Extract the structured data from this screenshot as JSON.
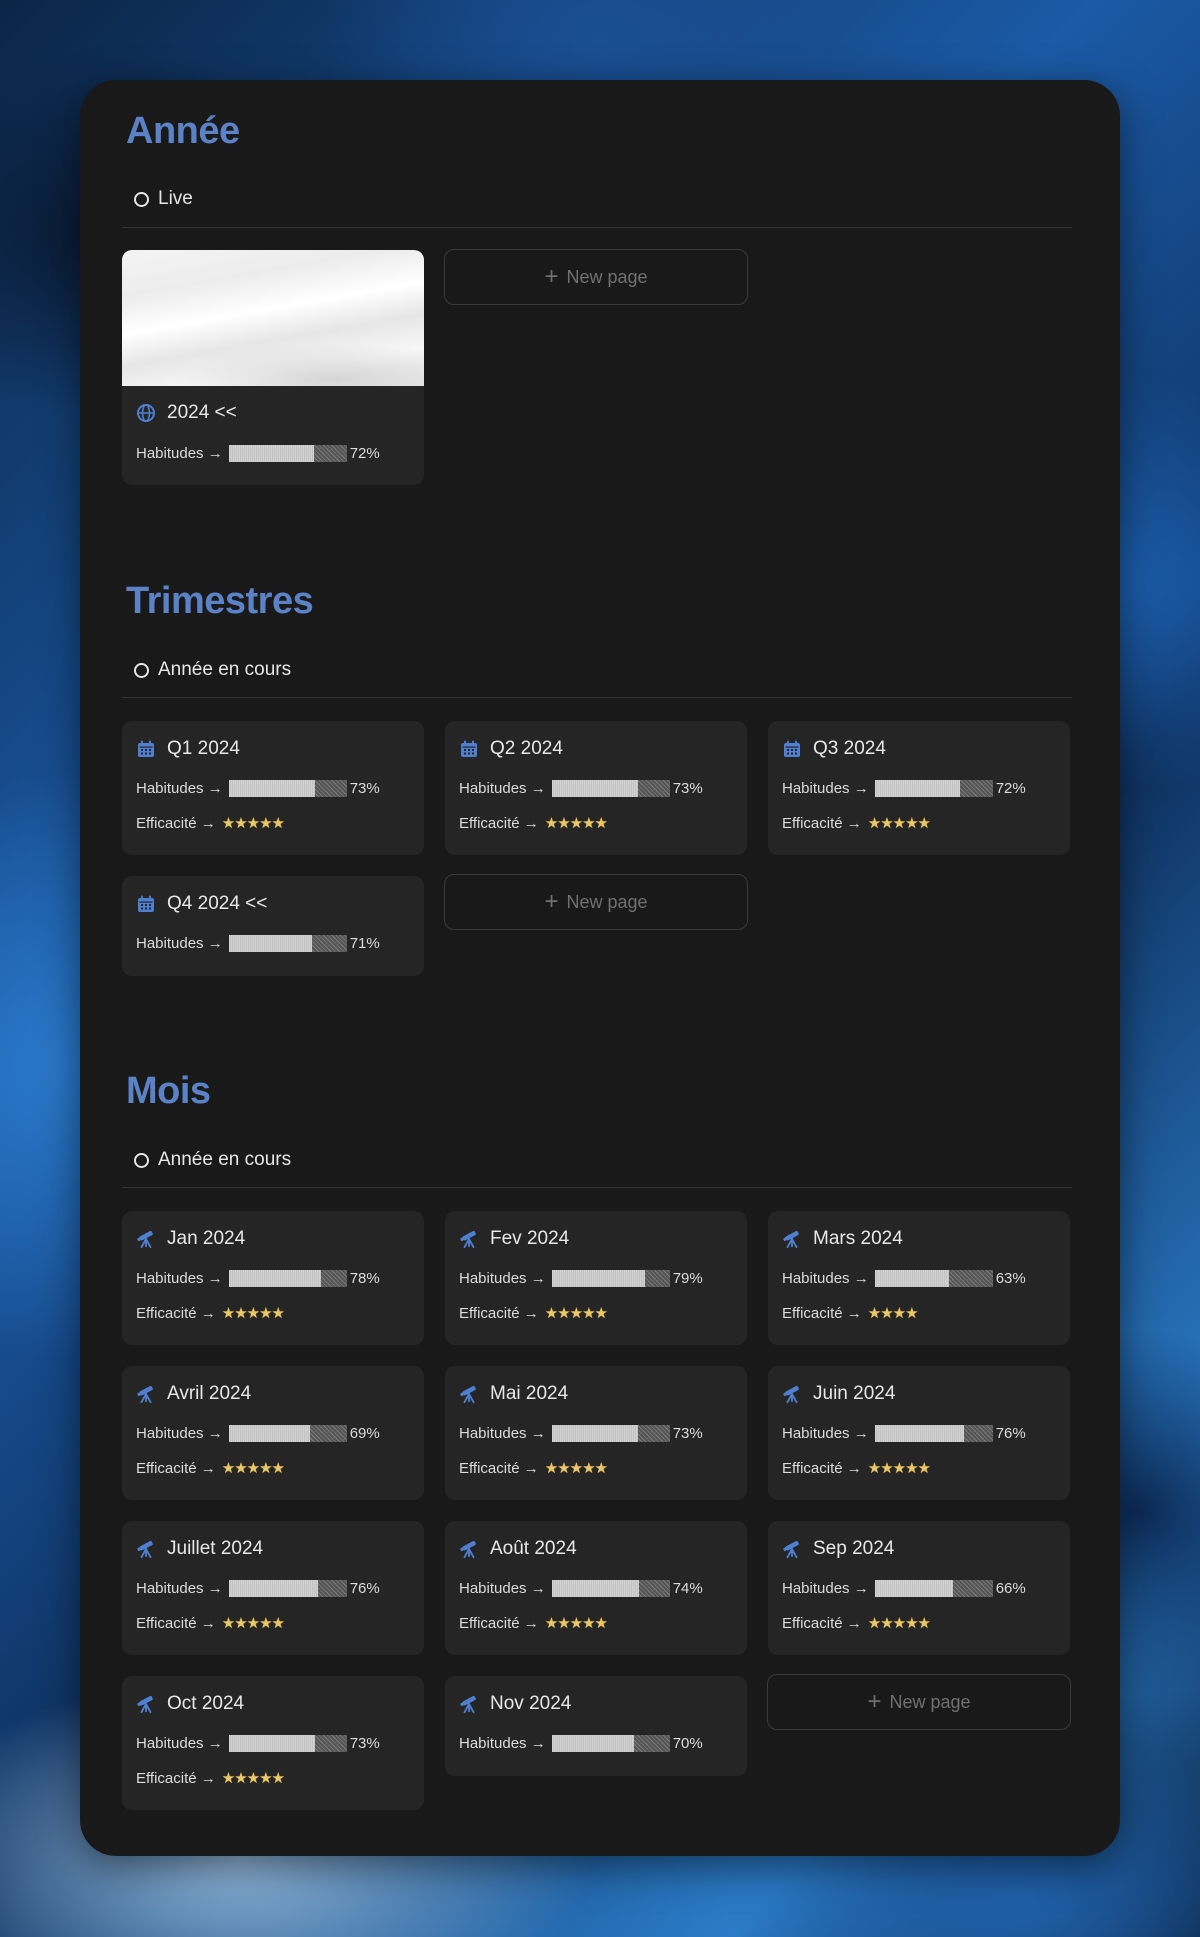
{
  "colors": {
    "accent": "#5b82c7",
    "panel": "#191919",
    "card": "#252525",
    "star": "#e9c86b"
  },
  "annee": {
    "title": "Année",
    "view": "Live",
    "cards": [
      {
        "title": "2024 <<",
        "icon": "globe-icon",
        "cover": true,
        "habitudes_label": "Habitudes →",
        "habitudes_pct": "72%",
        "habitudes_value": 72
      }
    ],
    "new_page": "New page"
  },
  "trimestres": {
    "title": "Trimestres",
    "view": "Année en cours",
    "cards": [
      {
        "title": "Q1 2024",
        "habitudes_label": "Habitudes →",
        "habitudes_pct": "73%",
        "habitudes_value": 73,
        "efficacite_label": "Efficacité →",
        "stars": "★★★★★"
      },
      {
        "title": "Q2 2024",
        "habitudes_label": "Habitudes →",
        "habitudes_pct": "73%",
        "habitudes_value": 73,
        "efficacite_label": "Efficacité →",
        "stars": "★★★★★"
      },
      {
        "title": "Q3 2024",
        "habitudes_label": "Habitudes →",
        "habitudes_pct": "72%",
        "habitudes_value": 72,
        "efficacite_label": "Efficacité →",
        "stars": "★★★★★"
      },
      {
        "title": "Q4 2024 <<",
        "habitudes_label": "Habitudes →",
        "habitudes_pct": "71%",
        "habitudes_value": 71
      }
    ],
    "new_page": "New page"
  },
  "mois": {
    "title": "Mois",
    "view": "Année en cours",
    "cards": [
      {
        "title": "Jan 2024",
        "habitudes_label": "Habitudes →",
        "habitudes_pct": "78%",
        "habitudes_value": 78,
        "efficacite_label": "Efficacité →",
        "stars": "★★★★★"
      },
      {
        "title": "Fev 2024",
        "habitudes_label": "Habitudes →",
        "habitudes_pct": "79%",
        "habitudes_value": 79,
        "efficacite_label": "Efficacité →",
        "stars": "★★★★★"
      },
      {
        "title": "Mars 2024",
        "habitudes_label": "Habitudes →",
        "habitudes_pct": "63%",
        "habitudes_value": 63,
        "efficacite_label": "Efficacité →",
        "stars": "★★★★"
      },
      {
        "title": "Avril 2024",
        "habitudes_label": "Habitudes →",
        "habitudes_pct": "69%",
        "habitudes_value": 69,
        "efficacite_label": "Efficacité →",
        "stars": "★★★★★"
      },
      {
        "title": "Mai 2024",
        "habitudes_label": "Habitudes →",
        "habitudes_pct": "73%",
        "habitudes_value": 73,
        "efficacite_label": "Efficacité →",
        "stars": "★★★★★"
      },
      {
        "title": "Juin 2024",
        "habitudes_label": "Habitudes →",
        "habitudes_pct": "76%",
        "habitudes_value": 76,
        "efficacite_label": "Efficacité →",
        "stars": "★★★★★"
      },
      {
        "title": "Juillet 2024",
        "habitudes_label": "Habitudes →",
        "habitudes_pct": "76%",
        "habitudes_value": 76,
        "efficacite_label": "Efficacité →",
        "stars": "★★★★★"
      },
      {
        "title": "Août 2024",
        "habitudes_label": "Habitudes →",
        "habitudes_pct": "74%",
        "habitudes_value": 74,
        "efficacite_label": "Efficacité →",
        "stars": "★★★★★"
      },
      {
        "title": "Sep 2024",
        "habitudes_label": "Habitudes →",
        "habitudes_pct": "66%",
        "habitudes_value": 66,
        "efficacite_label": "Efficacité →",
        "stars": "★★★★★"
      },
      {
        "title": "Oct 2024",
        "habitudes_label": "Habitudes →",
        "habitudes_pct": "73%",
        "habitudes_value": 73,
        "efficacite_label": "Efficacité →",
        "stars": "★★★★★"
      },
      {
        "title": "Nov 2024",
        "habitudes_label": "Habitudes →",
        "habitudes_pct": "70%",
        "habitudes_value": 70
      }
    ],
    "new_page": "New page"
  }
}
